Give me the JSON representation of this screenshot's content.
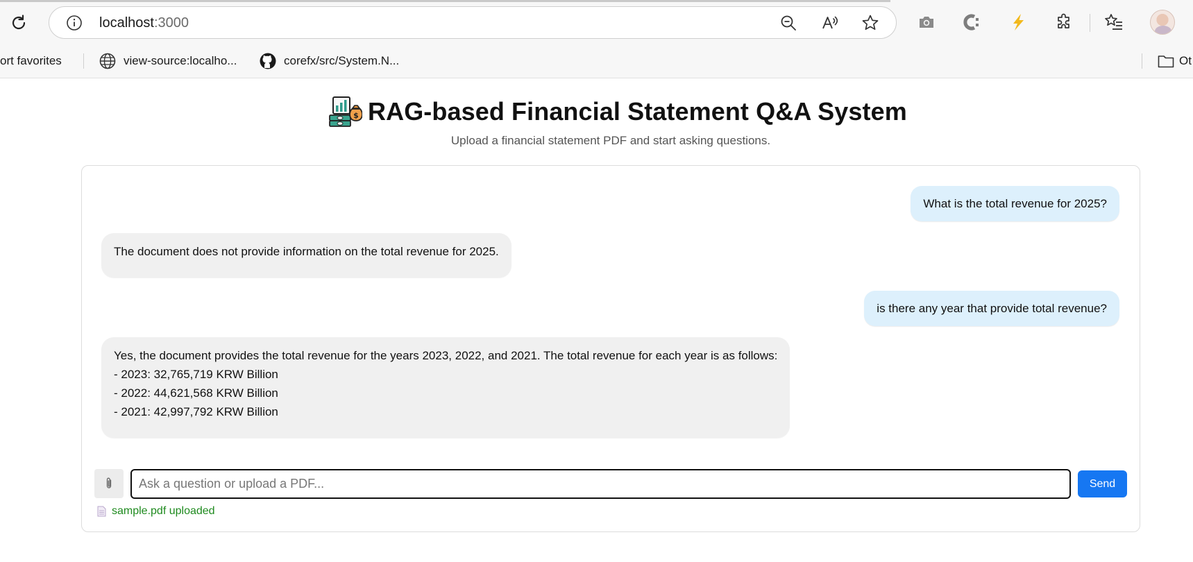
{
  "browser": {
    "url_host": "localhost",
    "url_port": ":3000"
  },
  "bookmarks": {
    "items": [
      {
        "label": "ort favorites"
      },
      {
        "label": "view-source:localho..."
      },
      {
        "label": "corefx/src/System.N..."
      },
      {
        "label": "Ot"
      }
    ]
  },
  "page": {
    "title": "RAG-based Financial Statement Q&A System",
    "subtitle": "Upload a financial statement PDF and start asking questions."
  },
  "chat": {
    "messages": [
      {
        "role": "user",
        "lines": [
          "What is the total revenue for 2025?"
        ]
      },
      {
        "role": "bot",
        "lines": [
          "The document does not provide information on the total revenue for 2025."
        ]
      },
      {
        "role": "user",
        "lines": [
          "is there any year that provide total revenue?"
        ]
      },
      {
        "role": "bot",
        "lines": [
          "Yes, the document provides the total revenue for the years 2023, 2022, and 2021. The total revenue for each year is as follows:",
          "- 2023: 32,765,719 KRW Billion",
          "- 2022: 44,621,568 KRW Billion",
          "- 2021: 42,997,792 KRW Billion"
        ]
      }
    ],
    "input": {
      "value": "",
      "placeholder": "Ask a question or upload a PDF..."
    },
    "send_label": "Send",
    "upload_status": "sample.pdf uploaded"
  },
  "colors": {
    "user_bubble": "#ddf0fc",
    "bot_bubble": "#f0f0f0",
    "send_button": "#1677f2",
    "upload_status": "#1e8a1e"
  }
}
